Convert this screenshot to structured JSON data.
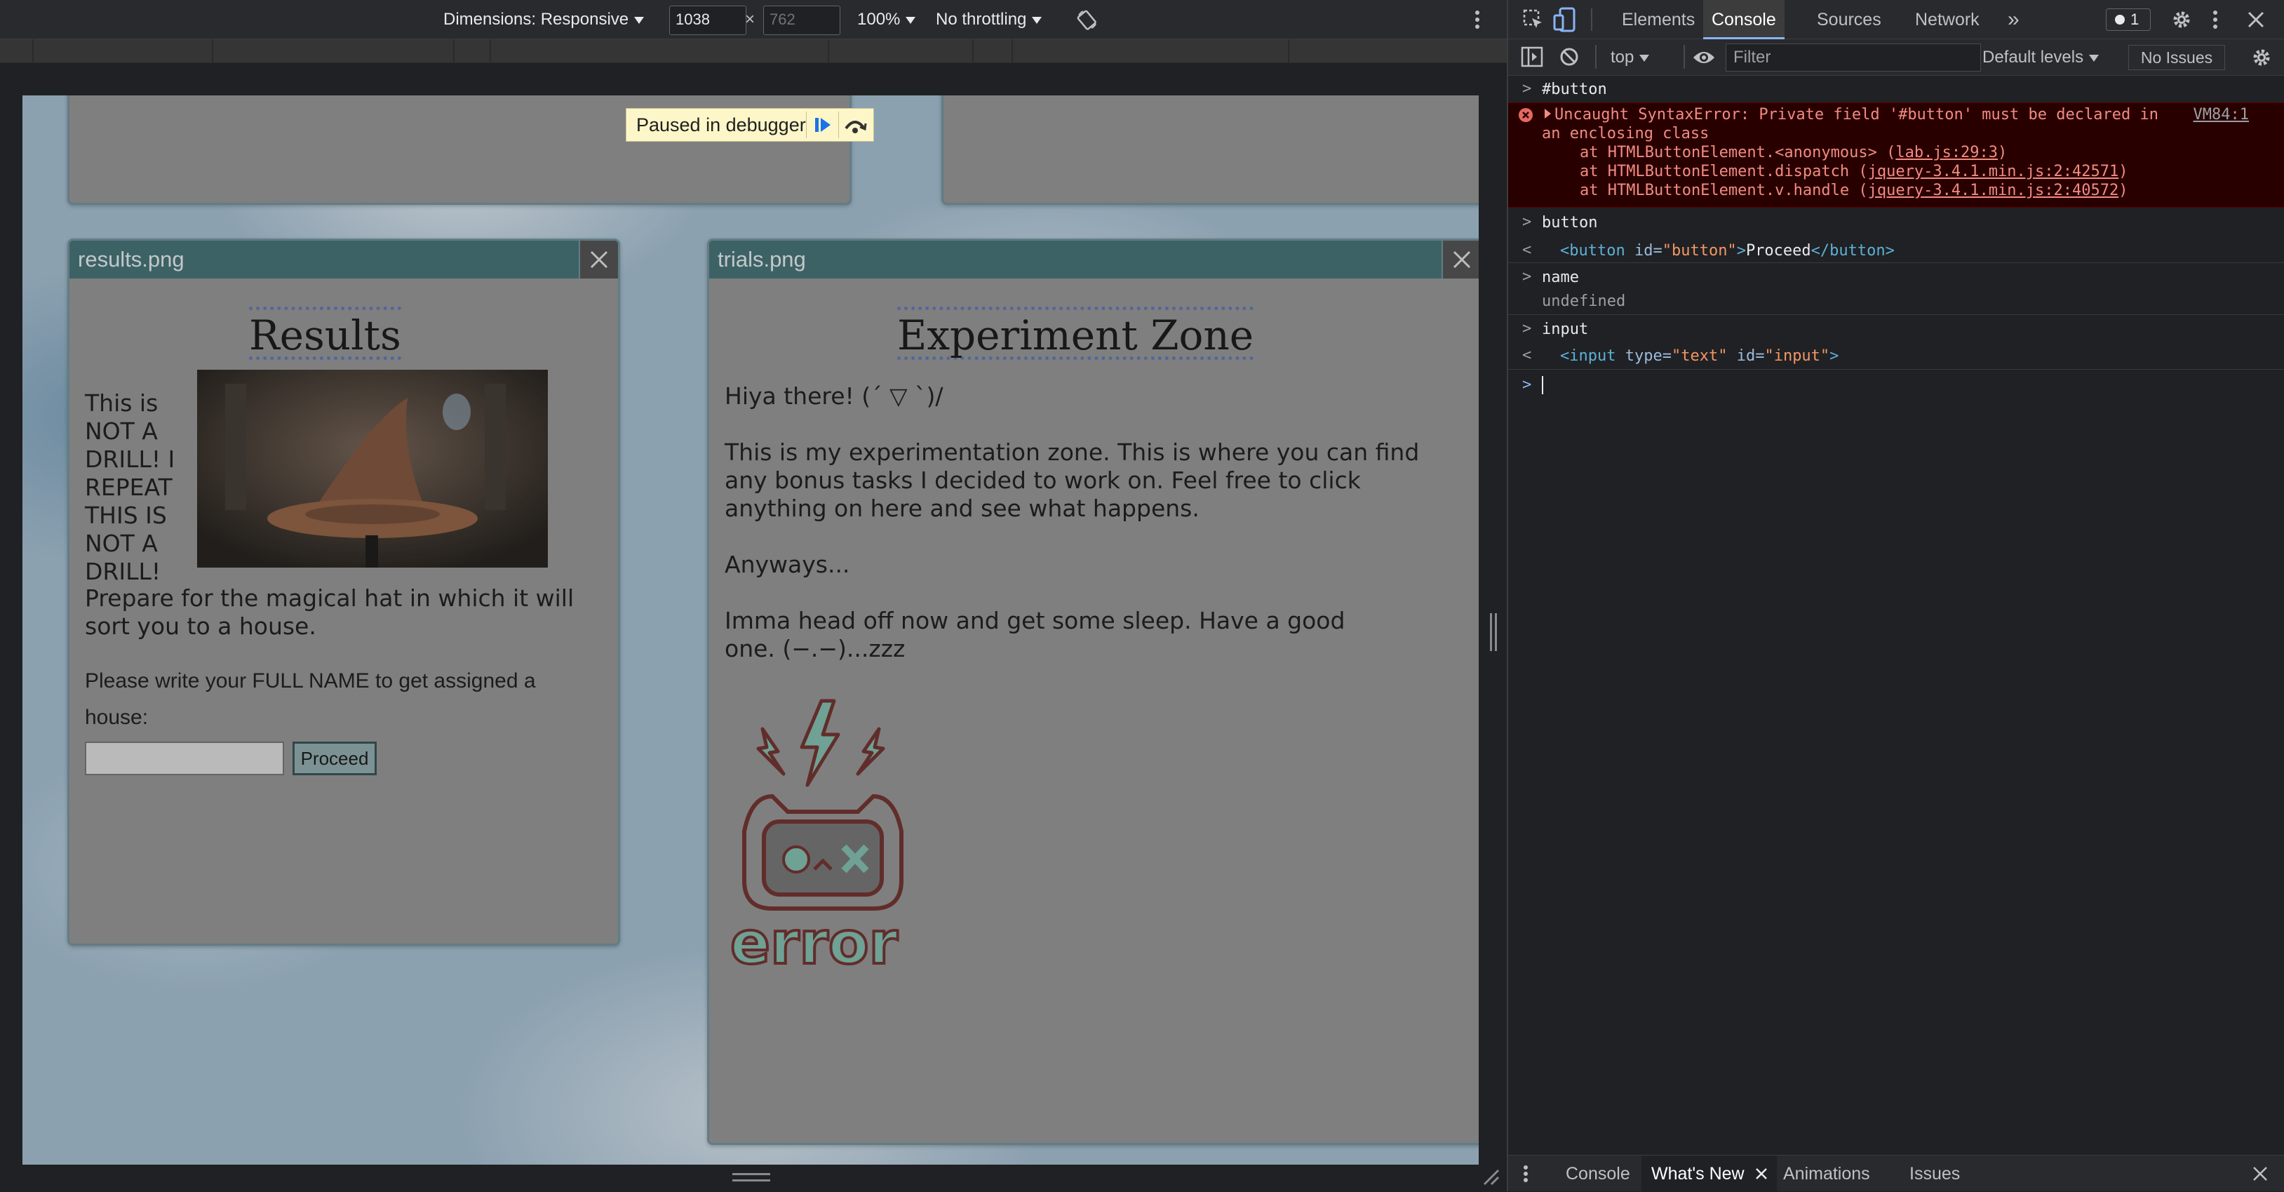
{
  "device_toolbar": {
    "dimensions_label": "Dimensions: Responsive",
    "width_value": "1038",
    "times": "×",
    "height_value": "762",
    "zoom_label": "100%",
    "throttle_label": "No throttling"
  },
  "debugger_badge": {
    "label": "Paused in debugger"
  },
  "page": {
    "results_window": {
      "title": "results.png",
      "heading": "Results",
      "side_text": "This is NOT A DRILL! I REPEAT THIS IS NOT A DRILL!",
      "follow_text": "Prepare for the magical hat in which it will sort you to a house.",
      "prompt_text": "Please write your FULL NAME to get assigned a house:",
      "name_input_value": "",
      "proceed_label": "Proceed"
    },
    "trials_window": {
      "title": "trials.png",
      "heading": "Experiment Zone",
      "p1": "Hiya there! (´ ▽ `)/",
      "p2": "This is my experimentation zone. This is where you can find any bonus tasks I decided to work on. Feel free to click anything on here and see what happens.",
      "p3": "Anyways...",
      "p4": "Imma head off now and get some sleep. Have a good one. (−.−)...zzz",
      "error_image_text": "error"
    }
  },
  "devtools": {
    "tabs": [
      "Elements",
      "Console",
      "Sources",
      "Network"
    ],
    "active_tab": "Console",
    "more_tabs": "»",
    "issues_badge": "1",
    "context_label": "top",
    "filter_placeholder": "Filter",
    "levels_label": "Default levels",
    "issues_label": "No Issues",
    "console": {
      "cmd1": "#button",
      "error_message": "Uncaught SyntaxError: Private field '#button' must be declared in",
      "error_message_cont": "an enclosing class",
      "error_source": "VM84:1",
      "stack1_prefix": "at HTMLButtonElement.<anonymous> (",
      "stack1_link": "lab.js:29:3",
      "stack2_prefix": "at HTMLButtonElement.dispatch (",
      "stack2_link": "jquery-3.4.1.min.js:2:42571",
      "stack3_prefix": "at HTMLButtonElement.v.handle (",
      "stack3_link": "jquery-3.4.1.min.js:2:40572",
      "close_paren": ")",
      "cmd2": "button",
      "result2_open": "<button",
      "result2_attr": "id",
      "result2_val": "\"button\"",
      "result2_text": "Proceed",
      "result2_close": "</button>",
      "cmd3": "name",
      "result3": "undefined",
      "cmd4": "input",
      "result4_open": "<input",
      "result4_attr1": "type",
      "result4_val1": "\"text\"",
      "result4_attr2": "id",
      "result4_val2": "\"input\"",
      "result4_end": ">"
    },
    "drawer_tabs": [
      "Console",
      "What's New",
      "Animations",
      "Issues"
    ],
    "drawer_active": "What's New"
  }
}
